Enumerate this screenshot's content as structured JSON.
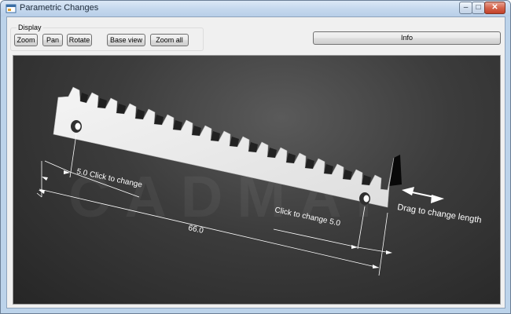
{
  "window": {
    "title": "Parametric Changes",
    "controls": {
      "minimize": "–",
      "maximize": "□",
      "close": "✕"
    }
  },
  "toolbar": {
    "group_label": "Display",
    "zoom": "Zoom",
    "pan": "Pan",
    "rotate": "Rotate",
    "base_view": "Base view",
    "zoom_all": "Zoom all",
    "info": "Info"
  },
  "viewport": {
    "watermark": "CADMAI",
    "hole_offset_left_label": "5.0 Click to change",
    "hole_offset_right_label": "Click to change 5.0",
    "length_label": "66.0",
    "drag_label": "Drag to change length"
  },
  "colors": {
    "viewport_bg": "#3c3c3c",
    "part_face": "#efefef",
    "part_end": "#0a0a0a",
    "dimension_lines": "#ffffff"
  },
  "icons": {
    "app": "app-form-icon"
  }
}
